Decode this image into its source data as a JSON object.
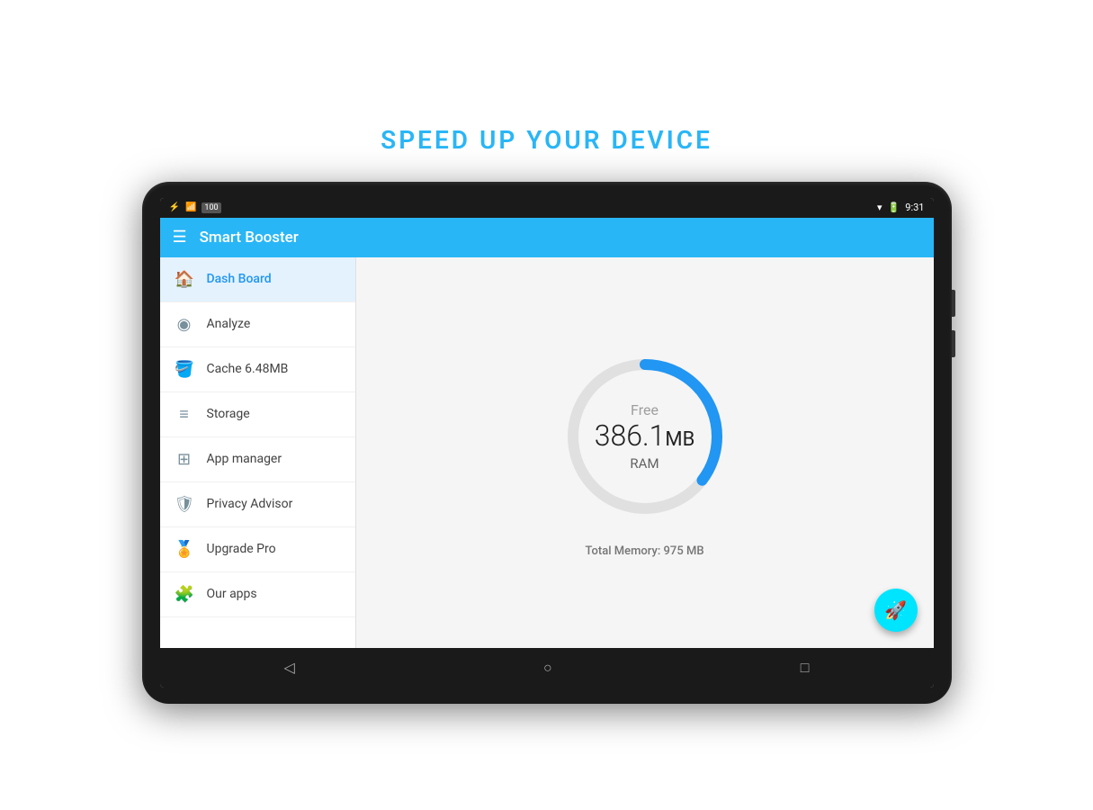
{
  "page": {
    "headline": "SPEED UP YOUR DEVICE"
  },
  "status_bar": {
    "time": "9:31"
  },
  "app_bar": {
    "title": "Smart Booster"
  },
  "sidebar": {
    "items": [
      {
        "id": "dashboard",
        "label": "Dash Board",
        "icon": "🏠",
        "active": true
      },
      {
        "id": "analyze",
        "label": "Analyze",
        "icon": "◎",
        "active": false
      },
      {
        "id": "cache",
        "label": "Cache 6.48MB",
        "icon": "🪣",
        "active": false
      },
      {
        "id": "storage",
        "label": "Storage",
        "icon": "☰",
        "active": false
      },
      {
        "id": "app-manager",
        "label": "App manager",
        "icon": "⊞",
        "active": false
      },
      {
        "id": "privacy",
        "label": "Privacy Advisor",
        "icon": "🛡",
        "active": false
      },
      {
        "id": "upgrade",
        "label": "Upgrade Pro",
        "icon": "🏅",
        "active": false
      },
      {
        "id": "our-apps",
        "label": "Our apps",
        "icon": "🧩",
        "active": false
      }
    ]
  },
  "main": {
    "free_label": "Free",
    "ram_value": "386.1",
    "ram_unit": "MB",
    "ram_label": "RAM",
    "total_memory_label": "Total Memory:",
    "total_memory_value": "975",
    "total_memory_unit": "MB",
    "circle_progress": 39.6,
    "circle_bg_color": "#e0e0e0",
    "circle_fg_color": "#2196f3"
  },
  "colors": {
    "accent": "#29b6f6",
    "fab": "#00e5ff",
    "active_nav": "#2196f3",
    "circle_track": "#e0e0e0",
    "circle_fill": "#2196f3"
  }
}
